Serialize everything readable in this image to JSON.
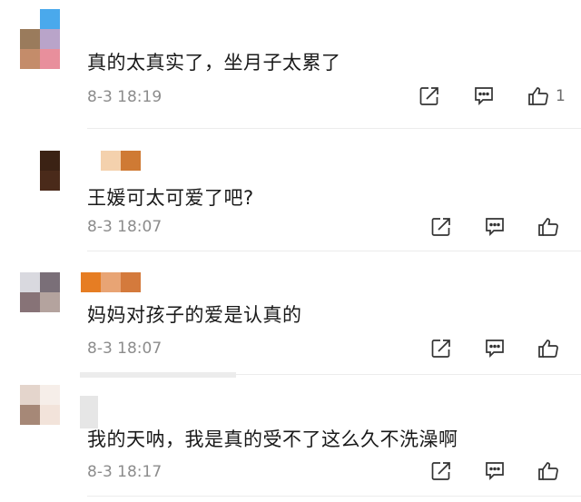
{
  "comments": [
    {
      "text": "真的太真实了，坐月子太累了",
      "date": "8-3 18:19",
      "likes": "1",
      "avatar_colors": [
        "#ffffff",
        "#4aa9ec",
        "#ffffff",
        "#9a7b5c",
        "#b9a4c9",
        "#ffffff",
        "#c48c6a",
        "#e88f9c",
        "#ffffff"
      ],
      "name_colors": []
    },
    {
      "text": "王媛可太可爱了吧?",
      "date": "8-3 18:07",
      "likes": "",
      "avatar_colors": [
        "#ffffff",
        "#3b2214",
        "#ffffff",
        "#4a2a1a",
        "#ffffff",
        "#ffffff"
      ],
      "name_colors": [
        "#f4d1ad",
        "#cf7a34"
      ]
    },
    {
      "text": "妈妈对孩子的爱是认真的",
      "date": "8-3 18:07",
      "likes": "",
      "avatar_colors": [
        "#d9d9df",
        "#7a6f78",
        "#877377",
        "#b4a39e"
      ],
      "name_colors": [
        "#e67d23",
        "#e8a474",
        "#d47a3c"
      ]
    },
    {
      "text": "我的天呐，我是真的受不了这么久不洗澡啊",
      "date": "8-3 18:17",
      "likes": "",
      "avatar_colors": [
        "#e4d5cc",
        "#f6eee9",
        "#a68877",
        "#f2e3da"
      ],
      "name_colors": []
    }
  ],
  "icons": {
    "share": "share-icon",
    "reply": "comment-icon",
    "like": "thumbs-up-icon"
  }
}
